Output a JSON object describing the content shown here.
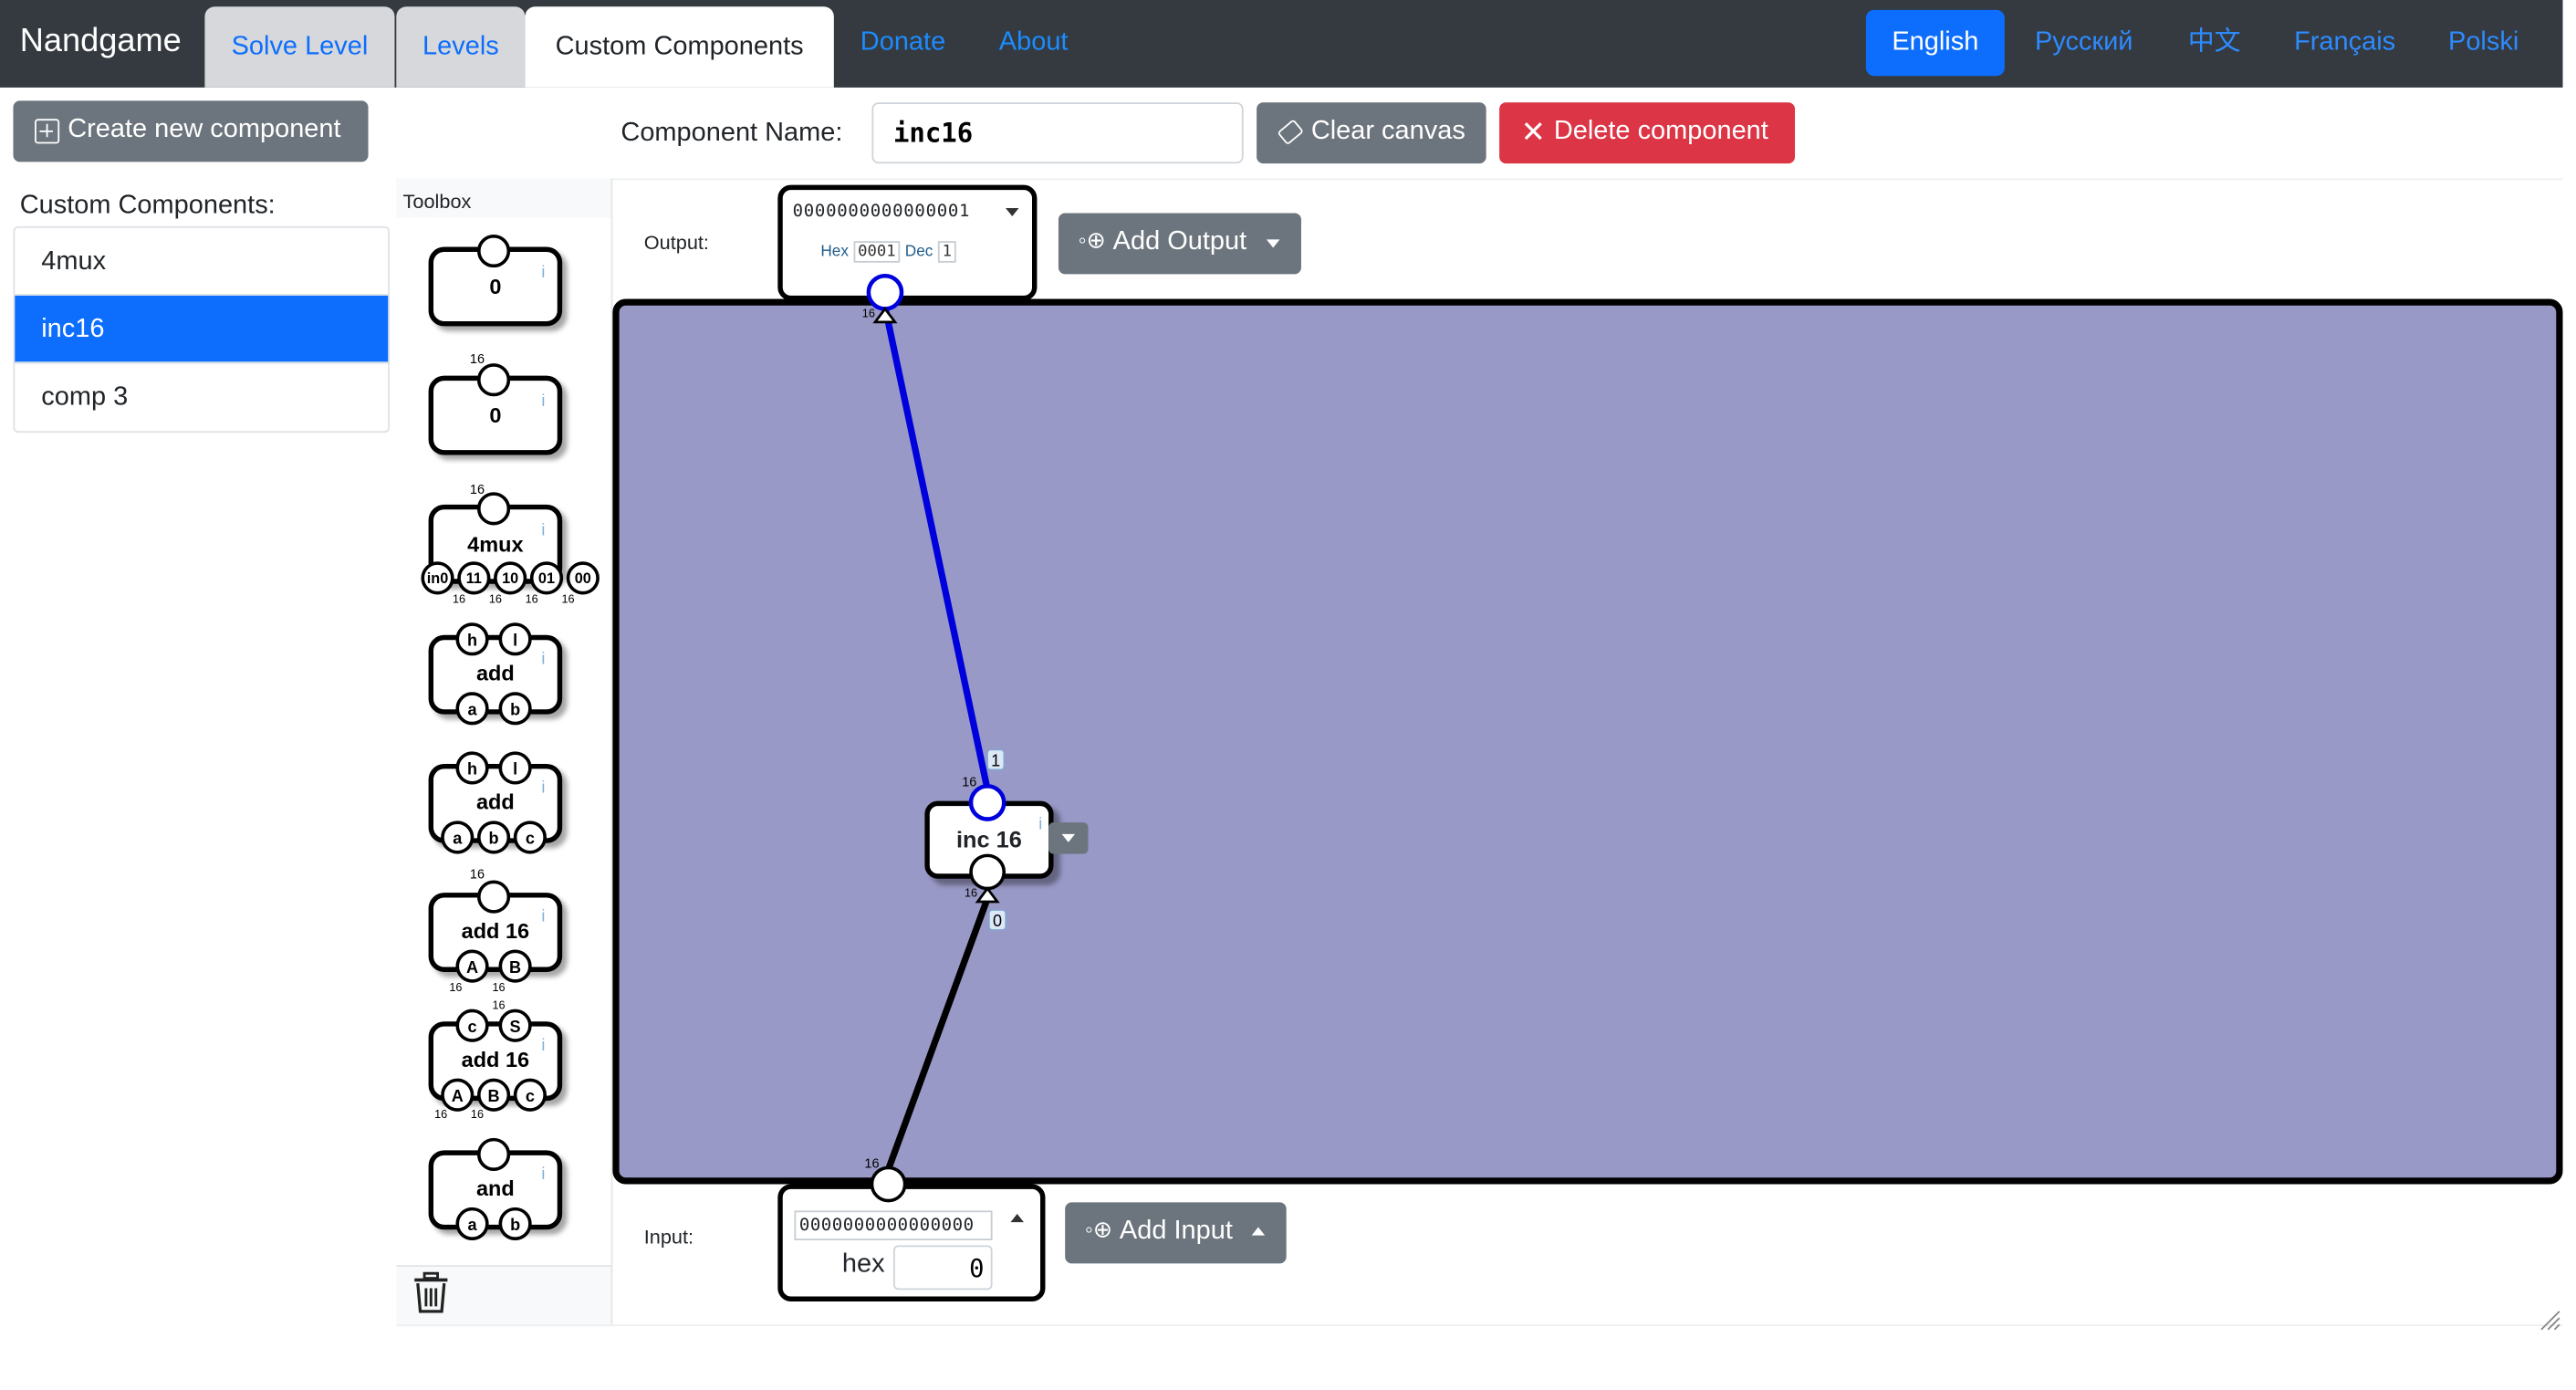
{
  "nav": {
    "brand": "Nandgame",
    "tabs": [
      {
        "label": "Solve Level"
      },
      {
        "label": "Levels"
      },
      {
        "label": "Custom Components"
      }
    ],
    "links": [
      {
        "label": "Donate"
      },
      {
        "label": "About"
      }
    ],
    "languages": [
      {
        "label": "English"
      },
      {
        "label": "Русский"
      },
      {
        "label": "中文"
      },
      {
        "label": "Français"
      },
      {
        "label": "Polski"
      }
    ],
    "active_language": "English"
  },
  "sidebar": {
    "create_button": "Create new component",
    "list_title": "Custom Components:",
    "items": [
      {
        "label": "4mux"
      },
      {
        "label": "inc16"
      },
      {
        "label": "comp 3"
      }
    ],
    "selected": "inc16"
  },
  "header": {
    "name_label": "Component Name:",
    "name_value": "inc16",
    "clear_button": "Clear canvas",
    "delete_button": "Delete component"
  },
  "toolbox": {
    "title": "Toolbox",
    "components": [
      {
        "name": "0",
        "inputs": [],
        "outputs": [
          ""
        ]
      },
      {
        "name": "0",
        "inputs": [],
        "outputs": [
          ""
        ],
        "bus_label": "16"
      },
      {
        "name": "4mux",
        "inputs": [
          "in0",
          "11",
          "10",
          "01",
          "00"
        ],
        "outputs": [
          ""
        ],
        "bus_label": "16"
      },
      {
        "name": "add",
        "inputs": [
          "a",
          "b"
        ],
        "outputs": [
          "h",
          "l"
        ]
      },
      {
        "name": "add",
        "inputs": [
          "a",
          "b",
          "c"
        ],
        "outputs": [
          "h",
          "l"
        ]
      },
      {
        "name": "add 16",
        "inputs": [
          "A",
          "B"
        ],
        "outputs": [
          ""
        ],
        "bus_label": "16"
      },
      {
        "name": "add 16",
        "inputs": [
          "A",
          "B",
          "c"
        ],
        "outputs": [
          "c",
          "S"
        ],
        "bus_label": "16"
      },
      {
        "name": "and",
        "inputs": [
          "a",
          "b"
        ],
        "outputs": [
          ""
        ]
      }
    ],
    "bus_width": "16"
  },
  "workspace": {
    "output_label": "Output:",
    "input_label": "Input:",
    "output_bits": "0000000000000001",
    "output_hex_label": "Hex",
    "output_hex": "0001",
    "output_dec_label": "Dec",
    "output_dec": "1",
    "input_bits": "0000000000000000",
    "input_hex_label": "hex",
    "input_hex": "0",
    "add_output_button": "Add Output",
    "add_input_button": "Add Input",
    "node": {
      "label": "inc 16",
      "bus_width": "16",
      "input_value": "0",
      "output_value": "1"
    },
    "canvas_color": "#9999c7",
    "active_wire_color": "#0000dd"
  }
}
